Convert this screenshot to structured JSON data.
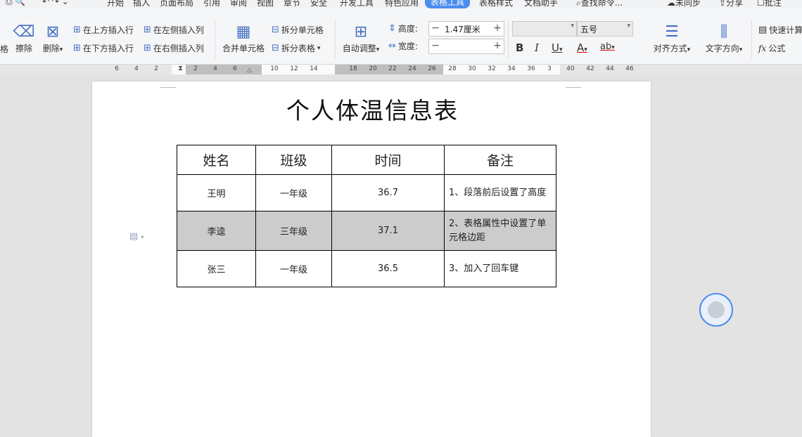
{
  "menubar": {
    "tabs": [
      "开始",
      "插入",
      "页面布局",
      "引用",
      "审阅",
      "视图",
      "章节",
      "安全",
      "开发工具",
      "特色应用",
      "表格工具",
      "表格样式",
      "文档助手"
    ],
    "active_tab": "表格工具",
    "search": "查找命令...",
    "sync": "未同步",
    "share": "分享",
    "comment": "批注"
  },
  "ribbon": {
    "cut_left": "格",
    "erase": "擦除",
    "delete": "删除",
    "insert_above": "在上方插入行",
    "insert_below": "在下方插入行",
    "insert_left": "在左侧插入列",
    "insert_right": "在右侧插入列",
    "merge_cells": "合并单元格",
    "split_cells": "拆分单元格",
    "split_table": "拆分表格",
    "auto_fit": "自动调整",
    "height_label": "高度:",
    "height_value": "1.47厘米",
    "width_label": "宽度:",
    "width_value": "",
    "font_name": "",
    "font_size": "五号",
    "bold": "B",
    "italic": "I",
    "underline": "U",
    "font_color": "A",
    "highlight": "ab",
    "align": "对齐方式",
    "text_direction": "文字方向",
    "quick_calc": "快速计算",
    "formula": "公式"
  },
  "ruler": {
    "ticks": [
      "6",
      "4",
      "2",
      "2",
      "4",
      "6",
      "10",
      "12",
      "14",
      "18",
      "20",
      "22",
      "24",
      "26",
      "28",
      "30",
      "32",
      "34",
      "36",
      "3",
      "40",
      "42",
      "44",
      "46"
    ]
  },
  "document": {
    "title": "个人体温信息表",
    "headers": [
      "姓名",
      "班级",
      "时间",
      "备注"
    ],
    "rows": [
      {
        "name": "王明",
        "class": "一年级",
        "temp": "36.7",
        "note": "1、段落前后设置了高度",
        "shaded": false
      },
      {
        "name": "李逵",
        "class": "三年级",
        "temp": "37.1",
        "note": "2、表格属性中设置了单元格边距",
        "shaded": true
      },
      {
        "name": "张三",
        "class": "一年级",
        "temp": "36.5",
        "note": "3、加入了回车键",
        "shaded": false
      }
    ]
  },
  "colors": {
    "accent": "#4a8df0",
    "shade": "#cccccc"
  }
}
